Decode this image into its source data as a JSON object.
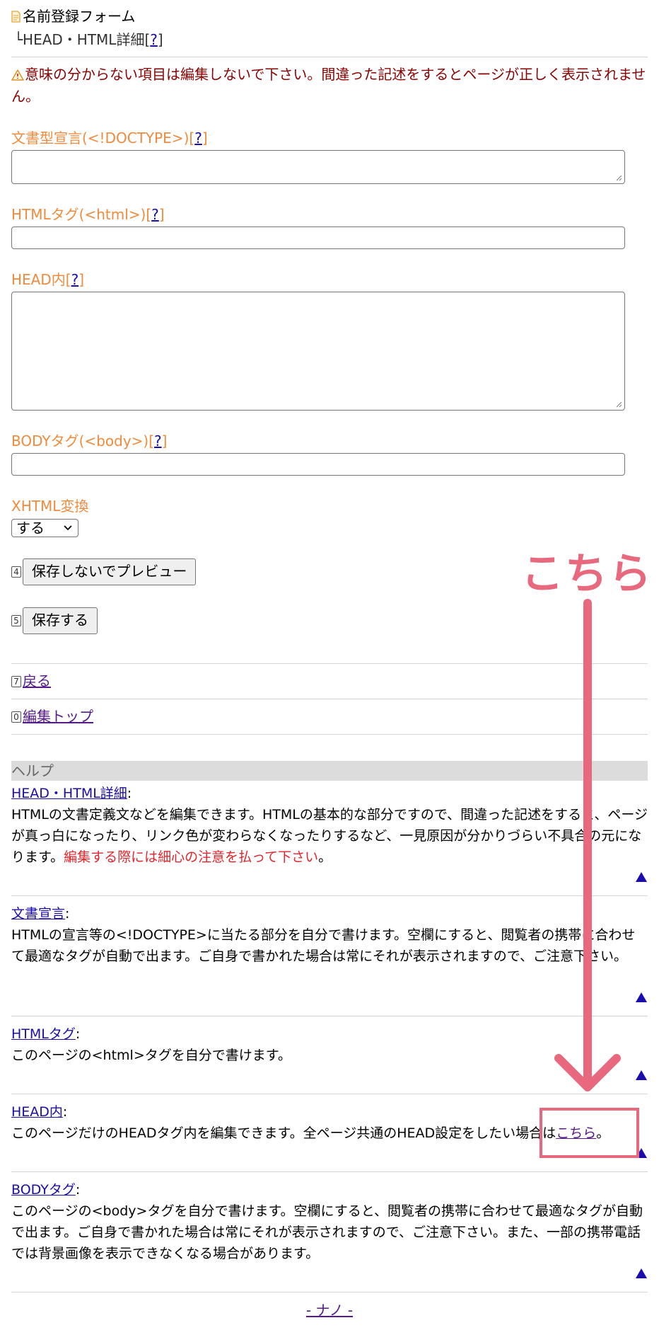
{
  "header": {
    "title": "名前登録フォーム",
    "sub_prefix": "└HEAD・HTML詳細[",
    "sub_link": "?",
    "sub_suffix": "]"
  },
  "warning": "意味の分からない項目は編集しないで下さい。間違った記述をするとページが正しく表示されません。",
  "fields": {
    "doctype": {
      "label": "文書型宣言(<!DOCTYPE>)",
      "help": "?"
    },
    "html": {
      "label": "HTMLタグ(<html>)",
      "help": "?"
    },
    "head": {
      "label": "HEAD内",
      "help": "?"
    },
    "body": {
      "label": "BODYタグ(<body>)",
      "help": "?"
    },
    "xhtml": {
      "label": "XHTML変換",
      "value": "する"
    }
  },
  "buttons": {
    "preview": {
      "key": "4",
      "label": "保存しないでプレビュー"
    },
    "save": {
      "key": "5",
      "label": "保存する"
    }
  },
  "nav": {
    "back": {
      "key": "7",
      "label": "戻る"
    },
    "top": {
      "key": "0",
      "label": "編集トップ"
    }
  },
  "help": {
    "heading": "ヘルプ",
    "s1": {
      "term": "HEAD・HTML詳細",
      "text": "HTMLの文書定義文などを編集できます。HTMLの基本的な部分ですので、間違った記述をすると、ページが真っ白になったり、リンク色が変わらなくなったりするなど、一見原因が分かりづらい不具合の元になります。",
      "red": "編集する際には細心の注意を払って下さい",
      "end": "。"
    },
    "s2": {
      "term": "文書宣言",
      "text": "HTMLの宣言等の<!DOCTYPE>に当たる部分を自分で書けます。空欄にすると、閲覧者の携帯に合わせて最適なタグが自動で出ます。ご自身で書かれた場合は常にそれが表示されますので、ご注意下さい。"
    },
    "s3": {
      "term": "HTMLタグ",
      "text": "このページの<html>タグを自分で書けます。"
    },
    "s4": {
      "term": "HEAD内",
      "text": "このページだけのHEADタグ内を編集できます。全ページ共通のHEAD設定をしたい場合は",
      "link": "こちら",
      "end": "。"
    },
    "s5": {
      "term": "BODYタグ",
      "text": "このページの<body>タグを自分で書けます。空欄にすると、閲覧者の携帯に合わせて最適なタグが自動で出ます。ご自身で書かれた場合は常にそれが表示されますので、ご注意下さい。また、一部の携帯電話では背景画像を表示できなくなる場合があります。"
    }
  },
  "footer": "- ナノ -",
  "annotation": {
    "text": "こちら",
    "color": "#e8697d"
  }
}
